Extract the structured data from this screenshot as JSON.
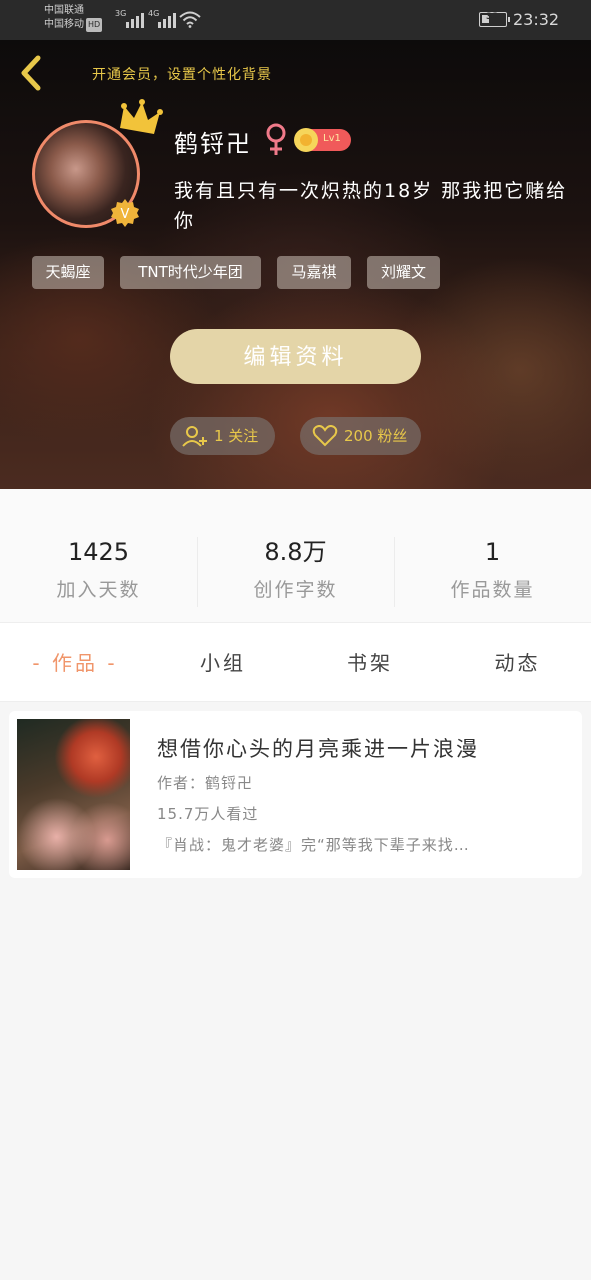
{
  "status_bar": {
    "carrier_1": "中国联通",
    "carrier_2": "中国移动",
    "hd": "HD",
    "net_1": "3G",
    "net_2": "4G",
    "battery": "33",
    "battery_level": 0.33,
    "time": "23:32"
  },
  "header": {
    "vip_promo": "开通会员，设置个性化背景",
    "nickname": "鹤锊卍",
    "level": "Lv1",
    "bio": "我有且只有一次炽热的18岁 那我把它赌给你",
    "verified_mark": "V",
    "tags": [
      "天蝎座",
      "TNT时代少年团",
      "马嘉祺",
      "刘耀文"
    ],
    "edit_button": "编辑资料",
    "follow_pill": "1 关注",
    "fans_pill": "200 粉丝"
  },
  "stats": [
    {
      "value": "1425",
      "label": "加入天数"
    },
    {
      "value": "8.8万",
      "label": "创作字数"
    },
    {
      "value": "1",
      "label": "作品数量"
    }
  ],
  "tabs": [
    "- 作品 -",
    "小组",
    "书架",
    "动态"
  ],
  "work": {
    "title": "想借你心头的月亮乘进一片浪漫",
    "author": "作者：鹤锊卍",
    "views": "15.7万人看过",
    "summary": "『肖战：鬼才老婆』完“那等我下辈子来找…"
  },
  "colors": {
    "accent": "#f0956a",
    "gold": "#e8c84a",
    "edit_button": "#e4d5a8",
    "level_badge": "#f05a5a"
  }
}
